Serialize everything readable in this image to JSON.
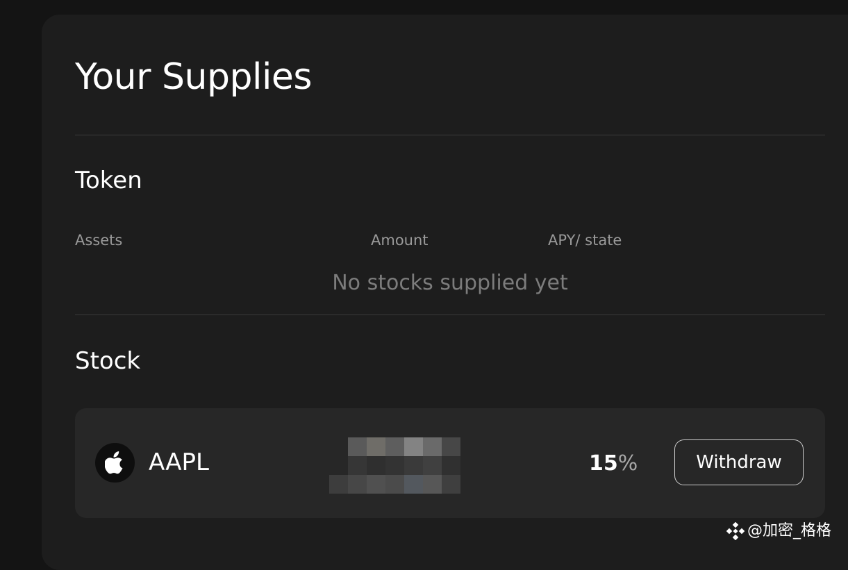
{
  "page": {
    "title": "Your Supplies"
  },
  "token_section": {
    "heading": "Token",
    "columns": [
      "Assets",
      "Amount",
      "APY/ state"
    ],
    "empty_message": "No stocks supplied yet"
  },
  "stock_section": {
    "heading": "Stock",
    "rows": [
      {
        "icon": "apple-logo-icon",
        "ticker": "AAPL",
        "amount": "",
        "amount_state": "pixelated / obscured",
        "apy_number": "15",
        "apy_symbol": "%",
        "action_label": "Withdraw"
      }
    ]
  },
  "watermark": {
    "text": "@加密_格格",
    "icon": "binance-logo-icon"
  },
  "colors": {
    "page_background": "#141414",
    "panel_background": "#1d1d1d",
    "row_background": "#272727",
    "muted_text": "#9a9a9a",
    "empty_text": "#7c7c7c",
    "button_border": "#cfcfcf"
  }
}
